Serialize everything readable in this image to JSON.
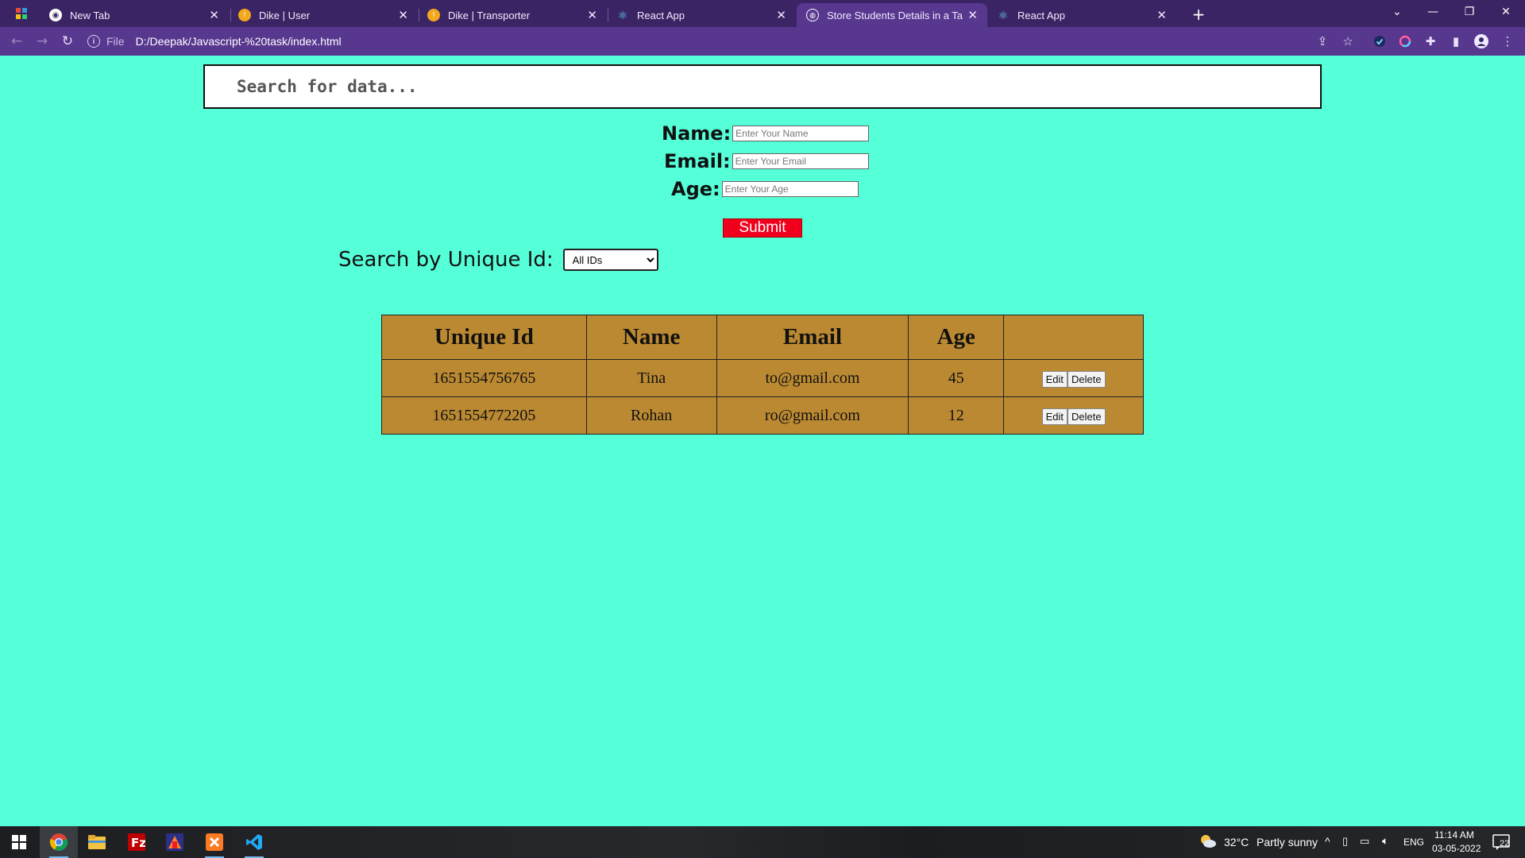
{
  "browser": {
    "tabs": [
      {
        "title": "New Tab",
        "icon": "chrome-icon",
        "active": false
      },
      {
        "title": "Dike | User",
        "icon": "dike-favicon-icon",
        "active": false
      },
      {
        "title": "Dike | Transporter",
        "icon": "dike-favicon-icon",
        "active": false
      },
      {
        "title": "React App",
        "icon": "react-icon",
        "active": false
      },
      {
        "title": "Store Students Details in a Table",
        "icon": "globe-icon",
        "active": true
      },
      {
        "title": "React App",
        "icon": "react-icon",
        "active": false
      }
    ],
    "url_scheme": "File",
    "url": "D:/Deepak/Javascript-%20task/index.html"
  },
  "page": {
    "search_placeholder": "Search for data...",
    "form": {
      "name_label": "Name:",
      "name_placeholder": "Enter Your Name",
      "email_label": "Email:",
      "email_placeholder": "Enter Your Email",
      "age_label": "Age:",
      "age_placeholder": "Enter Your Age",
      "submit_label": "Submit"
    },
    "filter": {
      "label": "Search by Unique Id:",
      "selected": "All IDs"
    },
    "table": {
      "headers": [
        "Unique Id",
        "Name",
        "Email",
        "Age",
        ""
      ],
      "rows": [
        {
          "id": "1651554756765",
          "name": "Tina",
          "email": "to@gmail.com",
          "age": "45"
        },
        {
          "id": "1651554772205",
          "name": "Rohan",
          "email": "ro@gmail.com",
          "age": "12"
        }
      ],
      "edit_label": "Edit",
      "delete_label": "Delete"
    }
  },
  "taskbar": {
    "weather_temp": "32°C",
    "weather_desc": "Partly sunny",
    "language": "ENG",
    "time": "11:14 AM",
    "date": "03-05-2022",
    "notification_count": "22"
  },
  "colors": {
    "page_background": "#55ffd8",
    "table_background": "#bb8931",
    "submit_background": "#f0001c",
    "tabbar": "#3b2463",
    "toolbar": "#58378f"
  }
}
